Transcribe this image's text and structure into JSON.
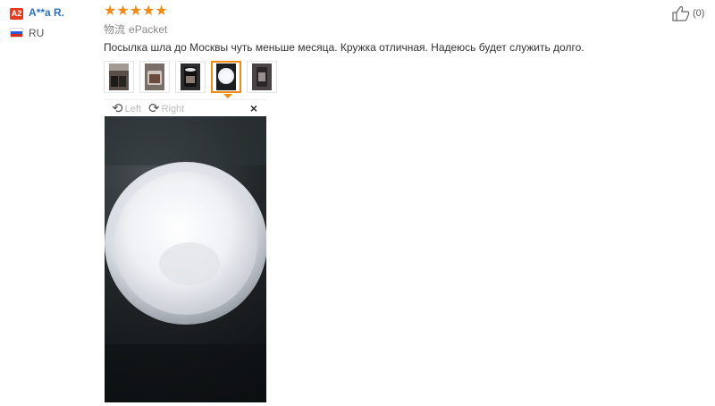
{
  "reviewer": {
    "level_badge": "A2",
    "name": "A**a R.",
    "country": "RU"
  },
  "review": {
    "rating": 5,
    "shipping_label": "物流",
    "shipping_method": "ePacket",
    "text": "Посылка шла до Москвы чуть меньше месяца. Кружка отличная. Надеюсь будет служить долго.",
    "likes": "(0)"
  },
  "viewer": {
    "rotate_left_label": "Left",
    "rotate_right_label": "Right",
    "close_symbol": "×"
  },
  "thumbnails": [
    {
      "active": false
    },
    {
      "active": false
    },
    {
      "active": false
    },
    {
      "active": true
    },
    {
      "active": false
    }
  ],
  "colors": {
    "accent": "#f08a16",
    "link": "#2f73ba",
    "badge": "#e43b1f"
  }
}
